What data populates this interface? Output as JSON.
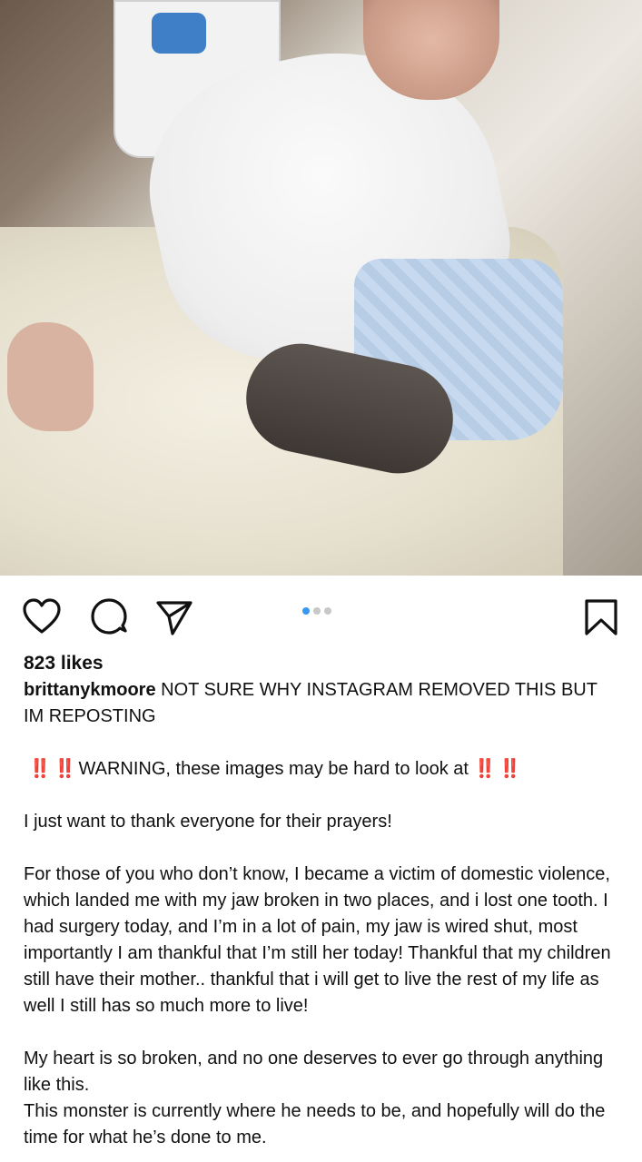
{
  "post": {
    "image_alt": "hospital bed photo",
    "carousel": {
      "count": 3,
      "active_index": 0
    },
    "likes": "823 likes",
    "username": "brittanykmoore",
    "caption_first": "NOT SURE WHY INSTAGRAM REMOVED THIS BUT IM REPOSTING",
    "warning_bang": "‼️",
    "warning_text": "WARNING, these images may be hard to look at",
    "paragraphs": [
      "I just want to thank everyone for their prayers!",
      "For those of you who don’t know, I became a victim of domestic violence, which landed me with my jaw broken in two places, and i lost one tooth. I had surgery today, and I’m in a lot of pain, my jaw is wired shut, most importantly I am thankful that I’m still her today! Thankful that my children still have their mother.. thankful that i will get to live the rest of my life as well I still has so much more to live!",
      "My heart is so broken, and no one deserves to ever go through anything like this.",
      "This monster is currently where he needs to be, and hopefully will do the time for what he’s done to me."
    ]
  },
  "icons": {
    "like": "heart-icon",
    "comment": "comment-icon",
    "share": "paper-plane-icon",
    "save": "bookmark-icon"
  },
  "colors": {
    "active_dot": "#3897f0",
    "inactive_dot": "#c8c8c8",
    "warning": "#e0192b"
  }
}
